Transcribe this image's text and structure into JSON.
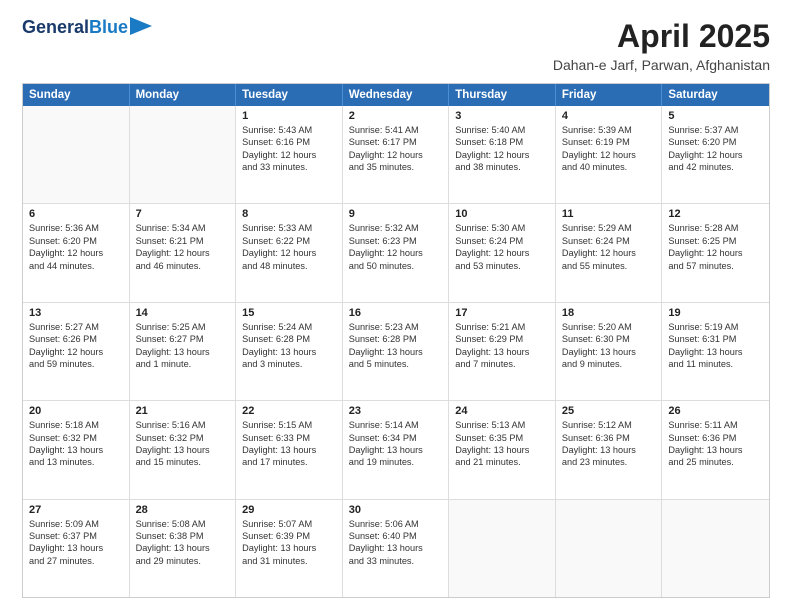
{
  "header": {
    "logo_line1": "General",
    "logo_line2": "Blue",
    "title": "April 2025",
    "subtitle": "Dahan-e Jarf, Parwan, Afghanistan"
  },
  "days": [
    "Sunday",
    "Monday",
    "Tuesday",
    "Wednesday",
    "Thursday",
    "Friday",
    "Saturday"
  ],
  "weeks": [
    [
      {
        "day": "",
        "lines": []
      },
      {
        "day": "",
        "lines": []
      },
      {
        "day": "1",
        "lines": [
          "Sunrise: 5:43 AM",
          "Sunset: 6:16 PM",
          "Daylight: 12 hours",
          "and 33 minutes."
        ]
      },
      {
        "day": "2",
        "lines": [
          "Sunrise: 5:41 AM",
          "Sunset: 6:17 PM",
          "Daylight: 12 hours",
          "and 35 minutes."
        ]
      },
      {
        "day": "3",
        "lines": [
          "Sunrise: 5:40 AM",
          "Sunset: 6:18 PM",
          "Daylight: 12 hours",
          "and 38 minutes."
        ]
      },
      {
        "day": "4",
        "lines": [
          "Sunrise: 5:39 AM",
          "Sunset: 6:19 PM",
          "Daylight: 12 hours",
          "and 40 minutes."
        ]
      },
      {
        "day": "5",
        "lines": [
          "Sunrise: 5:37 AM",
          "Sunset: 6:20 PM",
          "Daylight: 12 hours",
          "and 42 minutes."
        ]
      }
    ],
    [
      {
        "day": "6",
        "lines": [
          "Sunrise: 5:36 AM",
          "Sunset: 6:20 PM",
          "Daylight: 12 hours",
          "and 44 minutes."
        ]
      },
      {
        "day": "7",
        "lines": [
          "Sunrise: 5:34 AM",
          "Sunset: 6:21 PM",
          "Daylight: 12 hours",
          "and 46 minutes."
        ]
      },
      {
        "day": "8",
        "lines": [
          "Sunrise: 5:33 AM",
          "Sunset: 6:22 PM",
          "Daylight: 12 hours",
          "and 48 minutes."
        ]
      },
      {
        "day": "9",
        "lines": [
          "Sunrise: 5:32 AM",
          "Sunset: 6:23 PM",
          "Daylight: 12 hours",
          "and 50 minutes."
        ]
      },
      {
        "day": "10",
        "lines": [
          "Sunrise: 5:30 AM",
          "Sunset: 6:24 PM",
          "Daylight: 12 hours",
          "and 53 minutes."
        ]
      },
      {
        "day": "11",
        "lines": [
          "Sunrise: 5:29 AM",
          "Sunset: 6:24 PM",
          "Daylight: 12 hours",
          "and 55 minutes."
        ]
      },
      {
        "day": "12",
        "lines": [
          "Sunrise: 5:28 AM",
          "Sunset: 6:25 PM",
          "Daylight: 12 hours",
          "and 57 minutes."
        ]
      }
    ],
    [
      {
        "day": "13",
        "lines": [
          "Sunrise: 5:27 AM",
          "Sunset: 6:26 PM",
          "Daylight: 12 hours",
          "and 59 minutes."
        ]
      },
      {
        "day": "14",
        "lines": [
          "Sunrise: 5:25 AM",
          "Sunset: 6:27 PM",
          "Daylight: 13 hours",
          "and 1 minute."
        ]
      },
      {
        "day": "15",
        "lines": [
          "Sunrise: 5:24 AM",
          "Sunset: 6:28 PM",
          "Daylight: 13 hours",
          "and 3 minutes."
        ]
      },
      {
        "day": "16",
        "lines": [
          "Sunrise: 5:23 AM",
          "Sunset: 6:28 PM",
          "Daylight: 13 hours",
          "and 5 minutes."
        ]
      },
      {
        "day": "17",
        "lines": [
          "Sunrise: 5:21 AM",
          "Sunset: 6:29 PM",
          "Daylight: 13 hours",
          "and 7 minutes."
        ]
      },
      {
        "day": "18",
        "lines": [
          "Sunrise: 5:20 AM",
          "Sunset: 6:30 PM",
          "Daylight: 13 hours",
          "and 9 minutes."
        ]
      },
      {
        "day": "19",
        "lines": [
          "Sunrise: 5:19 AM",
          "Sunset: 6:31 PM",
          "Daylight: 13 hours",
          "and 11 minutes."
        ]
      }
    ],
    [
      {
        "day": "20",
        "lines": [
          "Sunrise: 5:18 AM",
          "Sunset: 6:32 PM",
          "Daylight: 13 hours",
          "and 13 minutes."
        ]
      },
      {
        "day": "21",
        "lines": [
          "Sunrise: 5:16 AM",
          "Sunset: 6:32 PM",
          "Daylight: 13 hours",
          "and 15 minutes."
        ]
      },
      {
        "day": "22",
        "lines": [
          "Sunrise: 5:15 AM",
          "Sunset: 6:33 PM",
          "Daylight: 13 hours",
          "and 17 minutes."
        ]
      },
      {
        "day": "23",
        "lines": [
          "Sunrise: 5:14 AM",
          "Sunset: 6:34 PM",
          "Daylight: 13 hours",
          "and 19 minutes."
        ]
      },
      {
        "day": "24",
        "lines": [
          "Sunrise: 5:13 AM",
          "Sunset: 6:35 PM",
          "Daylight: 13 hours",
          "and 21 minutes."
        ]
      },
      {
        "day": "25",
        "lines": [
          "Sunrise: 5:12 AM",
          "Sunset: 6:36 PM",
          "Daylight: 13 hours",
          "and 23 minutes."
        ]
      },
      {
        "day": "26",
        "lines": [
          "Sunrise: 5:11 AM",
          "Sunset: 6:36 PM",
          "Daylight: 13 hours",
          "and 25 minutes."
        ]
      }
    ],
    [
      {
        "day": "27",
        "lines": [
          "Sunrise: 5:09 AM",
          "Sunset: 6:37 PM",
          "Daylight: 13 hours",
          "and 27 minutes."
        ]
      },
      {
        "day": "28",
        "lines": [
          "Sunrise: 5:08 AM",
          "Sunset: 6:38 PM",
          "Daylight: 13 hours",
          "and 29 minutes."
        ]
      },
      {
        "day": "29",
        "lines": [
          "Sunrise: 5:07 AM",
          "Sunset: 6:39 PM",
          "Daylight: 13 hours",
          "and 31 minutes."
        ]
      },
      {
        "day": "30",
        "lines": [
          "Sunrise: 5:06 AM",
          "Sunset: 6:40 PM",
          "Daylight: 13 hours",
          "and 33 minutes."
        ]
      },
      {
        "day": "",
        "lines": []
      },
      {
        "day": "",
        "lines": []
      },
      {
        "day": "",
        "lines": []
      }
    ]
  ]
}
